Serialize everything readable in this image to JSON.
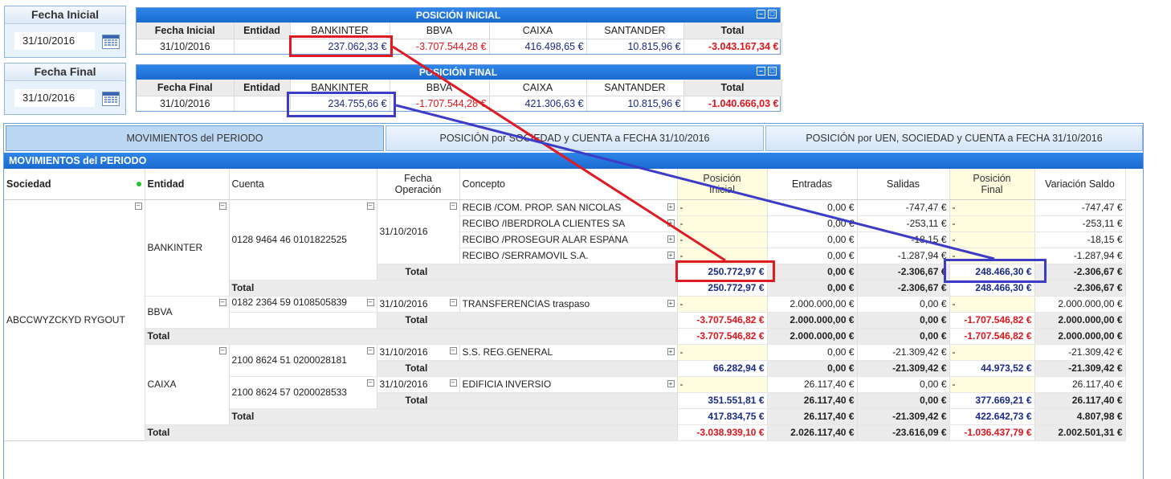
{
  "fecha_inicial": {
    "title": "Fecha Inicial",
    "value": "31/10/2016"
  },
  "fecha_final": {
    "title": "Fecha Final",
    "value": "31/10/2016"
  },
  "posicion_inicial": {
    "title": "POSICIÓN INICIAL",
    "headers": [
      "Fecha Inicial",
      "Entidad",
      "BANKINTER",
      "BBVA",
      "CAIXA",
      "SANTANDER",
      "Total"
    ],
    "row": {
      "fecha": "31/10/2016",
      "entidad": "",
      "bankinter": "237.062,33 €",
      "bbva": "-3.707.544,28 €",
      "caixa": "416.498,65 €",
      "santander": "10.815,96 €",
      "total": "-3.043.167,34 €"
    }
  },
  "posicion_final": {
    "title": "POSICIÓN FINAL",
    "headers": [
      "Fecha Final",
      "Entidad",
      "BANKINTER",
      "BBVA",
      "CAIXA",
      "SANTANDER",
      "Total"
    ],
    "row": {
      "fecha": "31/10/2016",
      "entidad": "",
      "bankinter": "234.755,66 €",
      "bbva": "-1.707.544,28 €",
      "caixa": "421.306,63 €",
      "santander": "10.815,96 €",
      "total": "-1.040.666,03 €"
    }
  },
  "tabs": [
    {
      "label": "MOVIMIENTOS del PERIODO"
    },
    {
      "label": "POSICIÓN por SOCIEDAD y CUENTA a  FECHA     31/10/2016"
    },
    {
      "label": "POSICIÓN por UEN, SOCIEDAD y CUENTA a  FECHA     31/10/2016"
    }
  ],
  "section_title": "MOVIMIENTOS del PERIODO",
  "columns": {
    "sociedad": "Sociedad",
    "entidad": "Entidad",
    "cuenta": "Cuenta",
    "fecha_op_1": "Fecha",
    "fecha_op_2": "Operación",
    "concepto": "Concepto",
    "pos_ini_1": "Posición",
    "pos_ini_2": "Inicial",
    "entradas": "Entradas",
    "salidas": "Salidas",
    "pos_fin_1": "Posición",
    "pos_fin_2": "Final",
    "variacion": "Variación Saldo"
  },
  "sociedad": "ABCCWYZCKYD RYGOUT",
  "total_label": "Total",
  "dash": "-",
  "bankinter": {
    "entidad": "BANKINTER",
    "cuenta": "0128 9464 46 0101822525",
    "fecha": "31/10/2016",
    "rows": [
      {
        "concepto": "RECIB /COM. PROP. SAN NICOLAS",
        "entradas": "0,00 €",
        "salidas": "-747,47 €",
        "variacion": "-747,47 €"
      },
      {
        "concepto": "RECIBO /IBERDROLA CLIENTES SA",
        "entradas": "0,00 €",
        "salidas": "-253,11 €",
        "variacion": "-253,11 €"
      },
      {
        "concepto": "RECIBO /PROSEGUR ALAR ESPANA",
        "entradas": "0,00 €",
        "salidas": "-18,15 €",
        "variacion": "-18,15 €"
      },
      {
        "concepto": "RECIBO /SERRAMOVIL S.A.",
        "entradas": "0,00 €",
        "salidas": "-1.287,94 €",
        "variacion": "-1.287,94 €"
      }
    ],
    "fecha_total": {
      "pos_ini": "250.772,97 €",
      "entradas": "0,00 €",
      "salidas": "-2.306,67 €",
      "pos_fin": "248.466,30 €",
      "variacion": "-2.306,67 €"
    },
    "cuenta_total": {
      "pos_ini": "250.772,97 €",
      "entradas": "0,00 €",
      "salidas": "-2.306,67 €",
      "pos_fin": "248.466,30 €",
      "variacion": "-2.306,67 €"
    }
  },
  "bbva": {
    "entidad": "BBVA",
    "cuenta": "0182 2364 59 0108505839",
    "fecha": "31/10/2016",
    "row": {
      "concepto": "TRANSFERENCIAS traspaso",
      "entradas": "2.000.000,00 €",
      "salidas": "0,00 €",
      "variacion": "2.000.000,00 €"
    },
    "fecha_total": {
      "pos_ini": "-3.707.546,82 €",
      "entradas": "2.000.000,00 €",
      "salidas": "0,00 €",
      "pos_fin": "-1.707.546,82 €",
      "variacion": "2.000.000,00 €"
    },
    "cuenta_total": {
      "pos_ini": "-3.707.546,82 €",
      "entradas": "2.000.000,00 €",
      "salidas": "0,00 €",
      "pos_fin": "-1.707.546,82 €",
      "variacion": "2.000.000,00 €"
    }
  },
  "caixa": {
    "entidad": "CAIXA",
    "cuenta1": "2100 8624 51 0200028181",
    "cuenta1_fecha": "31/10/2016",
    "cuenta1_row": {
      "concepto": "S.S. REG.GENERAL",
      "entradas": "0,00 €",
      "salidas": "-21.309,42 €",
      "variacion": "-21.309,42 €"
    },
    "cuenta1_total": {
      "pos_ini": "66.282,94 €",
      "entradas": "0,00 €",
      "salidas": "-21.309,42 €",
      "pos_fin": "44.973,52 €",
      "variacion": "-21.309,42 €"
    },
    "cuenta2": "2100 8624 57 0200028533",
    "cuenta2_fecha": "31/10/2016",
    "cuenta2_row": {
      "concepto": "EDIFICIA INVERSIO",
      "entradas": "26.117,40 €",
      "salidas": "0,00 €",
      "variacion": "26.117,40 €"
    },
    "cuenta2_total": {
      "pos_ini": "351.551,81 €",
      "entradas": "26.117,40 €",
      "salidas": "0,00 €",
      "pos_fin": "377.669,21 €",
      "variacion": "26.117,40 €"
    },
    "entidad_total": {
      "pos_ini": "417.834,75 €",
      "entradas": "26.117,40 €",
      "salidas": "-21.309,42 €",
      "pos_fin": "422.642,73 €",
      "variacion": "4.807,98 €"
    }
  },
  "grand_total": {
    "pos_ini": "-3.038.939,10 €",
    "entradas": "2.026.117,40 €",
    "salidas": "-23.616,09 €",
    "pos_fin": "-1.036.437,79 €",
    "variacion": "2.002.501,31 €"
  },
  "colors": {
    "header_blue": "#1a6ad0",
    "highlight_red": "#e01a22",
    "highlight_blue": "#3c3cc8",
    "yellow_col": "#fffde0",
    "negative": "#e0141a",
    "positive": "#1a2a8a"
  }
}
